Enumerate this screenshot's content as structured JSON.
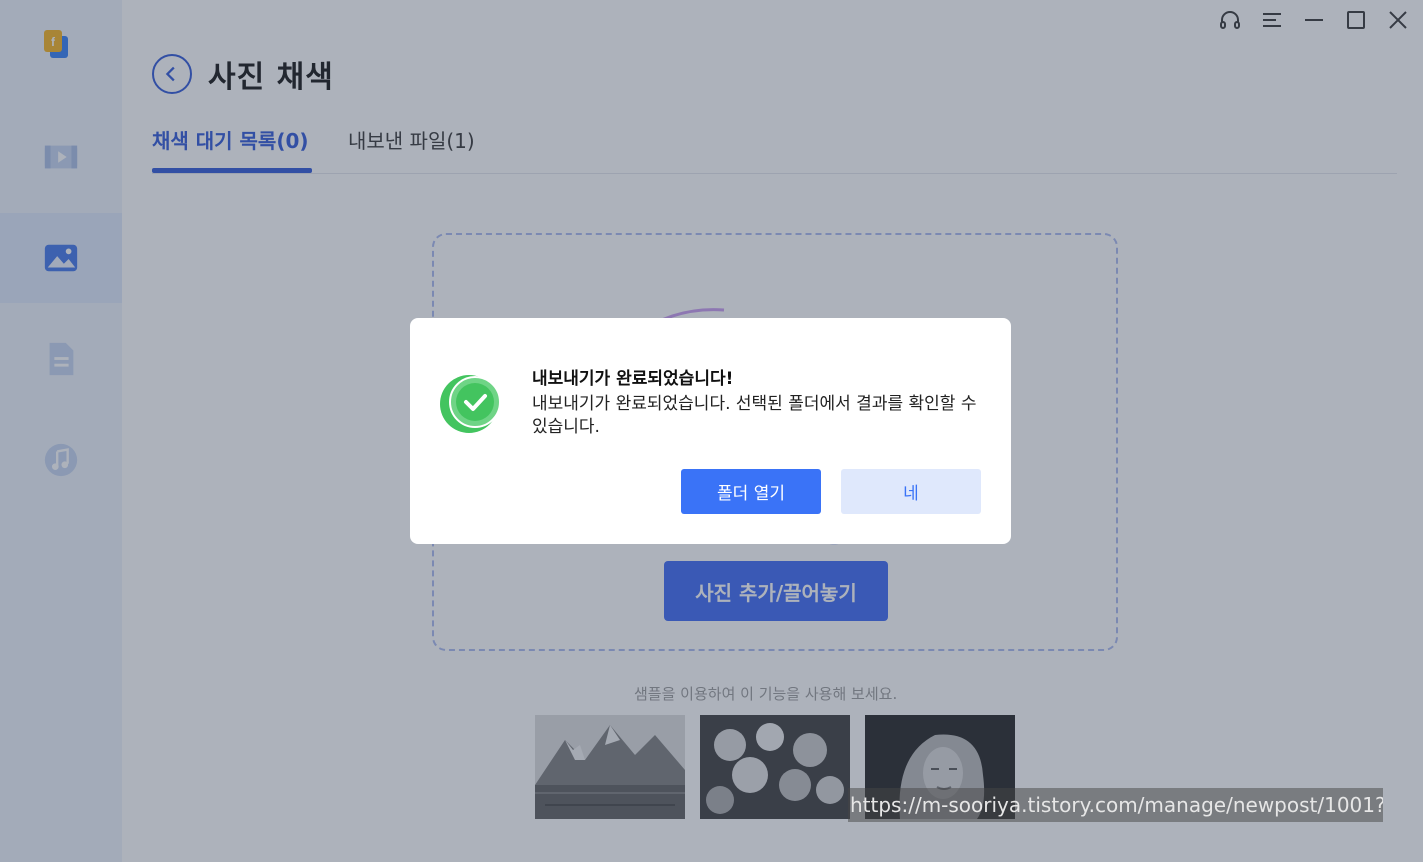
{
  "header": {
    "title": "사진 채색",
    "back_icon": "back-arrow-icon"
  },
  "tabs": [
    {
      "label": "채색 대기 목록(0)",
      "active": true
    },
    {
      "label": "내보낸 파일(1)",
      "active": false
    }
  ],
  "sidebar": {
    "items": [
      {
        "icon": "video-icon",
        "active": false
      },
      {
        "icon": "image-icon",
        "active": true
      },
      {
        "icon": "document-icon",
        "active": false
      },
      {
        "icon": "music-icon",
        "active": false
      }
    ]
  },
  "window_controls": [
    "headset-icon",
    "menu-icon",
    "minimize-icon",
    "maximize-icon",
    "close-icon"
  ],
  "main": {
    "add_button_label": "사진 추가/끌어놓기",
    "sample_text": "샘플을 이용하여 이 기능을 사용해 보세요.",
    "samples": [
      "mountain-lake",
      "flower-bouquet",
      "portrait-woman"
    ]
  },
  "dialog": {
    "title": "내보내기가 완료되었습니다!",
    "message": "내보내기가 완료되었습니다. 선택된 폴더에서 결과를 확인할 수 있습니다.",
    "open_folder_label": "폴더 열기",
    "ok_label": "네"
  },
  "watermark": "https://m-sooriya.tistory.com/manage/newpost/1001?",
  "colors": {
    "accent": "#2b55d8",
    "button_blue": "#3a73f7",
    "success_green": "#43c45f"
  }
}
